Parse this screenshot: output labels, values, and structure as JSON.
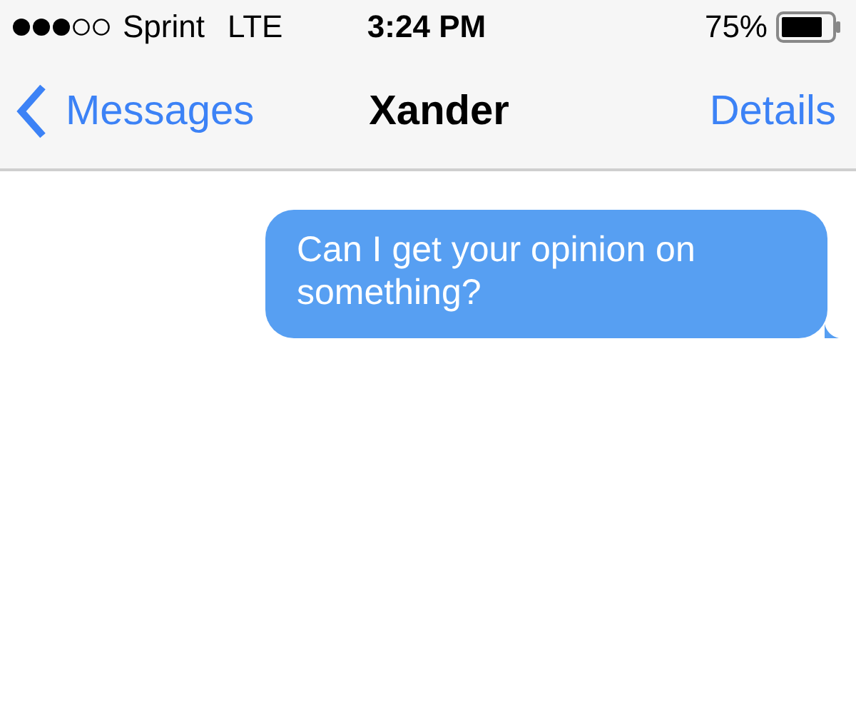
{
  "status_bar": {
    "carrier": "Sprint",
    "network": "LTE",
    "time": "3:24 PM",
    "battery": "75%"
  },
  "nav_bar": {
    "back": "Messages",
    "title": "Xander",
    "action": "Details"
  },
  "messages": [
    {
      "kind": "sent",
      "text": "Can I get your opinion on something?"
    }
  ]
}
